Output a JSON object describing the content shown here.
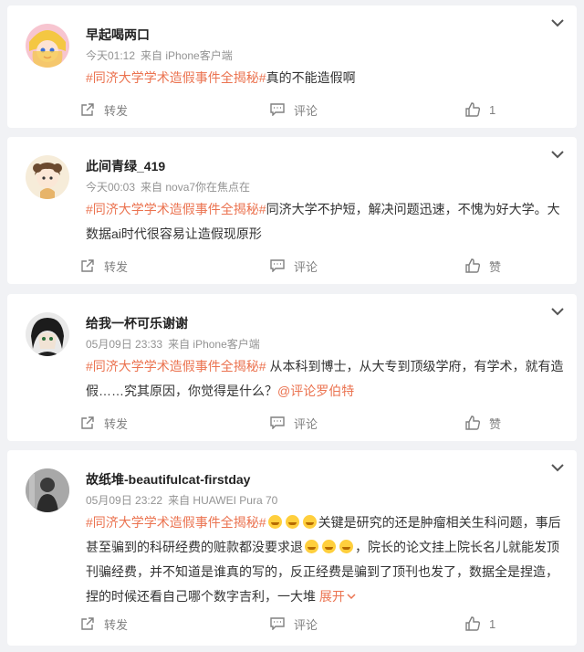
{
  "comments": [
    {
      "username": "早起喝两口",
      "time": "今天01:12",
      "source": "来自 iPhone客户端",
      "topic": "#同济大学学术造假事件全揭秘#",
      "text": "真的不能造假啊",
      "share_label": "转发",
      "comment_label": "评论",
      "like_label": "1"
    },
    {
      "username": "此间青绿_419",
      "time": "今天00:03",
      "source": "来自 nova7你在焦点在",
      "topic": "#同济大学学术造假事件全揭秘#",
      "text": "同济大学不护短，解决问题迅速，不愧为好大学。大数据ai时代很容易让造假现原形",
      "share_label": "转发",
      "comment_label": "评论",
      "like_label": "赞"
    },
    {
      "username": "给我一杯可乐谢谢",
      "time": "05月09日 23:33",
      "source": "来自 iPhone客户端",
      "topic": "#同济大学学术造假事件全揭秘#",
      "text": " 从本科到博士，从大专到顶级学府，有学术，就有造假……究其原因，你觉得是什么？",
      "mention": "@评论罗伯特",
      "share_label": "转发",
      "comment_label": "评论",
      "like_label": "赞"
    },
    {
      "username": "故纸堆-beautifulcat-firstday",
      "time": "05月09日 23:22",
      "source": "来自 HUAWEI Pura 70",
      "topic": "#同济大学学术造假事件全揭秘#",
      "text_a": "关键是研究的还是肿瘤相关生科问题，事后甚至骗到的科研经费的赃款都没要求退",
      "text_b": "，院长的论文挂上院长名儿就能发顶刊骗经费，并不知道是谁真的写的，反正经费是骗到了顶刊也发了，数据全是捏造，捏的时候还看自己哪个数字吉利，一大堆",
      "expand_label": "展开",
      "share_label": "转发",
      "comment_label": "评论",
      "like_label": "1"
    }
  ],
  "icons": {
    "collapse": "chevron-down-icon",
    "share": "share-icon",
    "comment": "comment-icon",
    "like": "thumbs-up-icon",
    "emoji": "laughing-emoji-icon"
  },
  "colors": {
    "topic": "#eb7350",
    "meta": "#939393",
    "action": "#808080",
    "background": "#f1f2f5"
  }
}
